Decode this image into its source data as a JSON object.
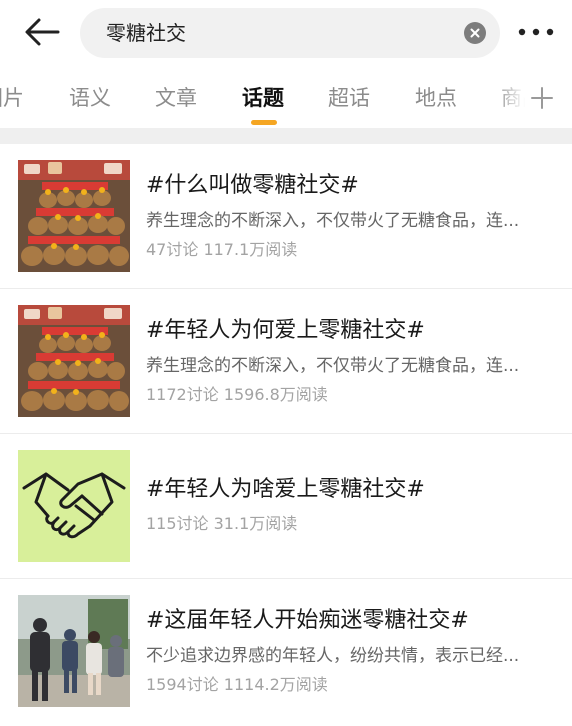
{
  "search": {
    "query": "零糖社交"
  },
  "tabs": [
    {
      "label": "图片"
    },
    {
      "label": "语义"
    },
    {
      "label": "文章"
    },
    {
      "label": "话题"
    },
    {
      "label": "超话"
    },
    {
      "label": "地点"
    },
    {
      "label": "商品"
    }
  ],
  "active_tab": "话题",
  "colors": {
    "accent": "#f5a623",
    "tab_inactive": "#8c8c8c",
    "meta": "#a3a3a3"
  },
  "icons": {
    "back": "arrow-left-icon",
    "clear": "clear-circle-icon",
    "more": "more-dots-icon",
    "add": "plus-icon"
  },
  "topics": [
    {
      "title": "#什么叫做零糖社交#",
      "desc": "养生理念的不断深入，不仅带火了无糖食品，连...",
      "meta": "47讨论 117.1万阅读",
      "thumb": "plush-toys"
    },
    {
      "title": "#年轻人为何爱上零糖社交#",
      "desc": "养生理念的不断深入，不仅带火了无糖食品，连...",
      "meta": "1172讨论 1596.8万阅读",
      "thumb": "plush-toys"
    },
    {
      "title": "#年轻人为啥爱上零糖社交#",
      "desc": "",
      "meta": "115讨论 31.1万阅读",
      "thumb": "handshake"
    },
    {
      "title": "#这届年轻人开始痴迷零糖社交#",
      "desc": "不少追求边界感的年轻人，纷纷共情，表示已经...",
      "meta": "1594讨论 1114.2万阅读",
      "thumb": "people-photo"
    }
  ]
}
